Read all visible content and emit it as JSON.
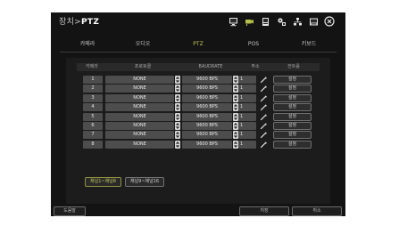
{
  "title": {
    "prefix": "장치>",
    "name": "PTZ"
  },
  "toolbar_icons": [
    "monitor-icon",
    "camera-icon",
    "record-icon",
    "network-icon",
    "storage-icon",
    "close-icon"
  ],
  "tabs": [
    {
      "label": "카메라",
      "active": false
    },
    {
      "label": "오디오",
      "active": false
    },
    {
      "label": "PTZ",
      "active": true
    },
    {
      "label": "POS",
      "active": false
    },
    {
      "label": "키보드",
      "active": false
    }
  ],
  "columns": [
    "카메라",
    "프로토콜",
    "BAUDRATE",
    "주소",
    "컨트롤"
  ],
  "rows": [
    {
      "camera": "1",
      "protocol": "NONE",
      "baud": "9600 BPS",
      "address": "1",
      "control": "설정"
    },
    {
      "camera": "2",
      "protocol": "NONE",
      "baud": "9600 BPS",
      "address": "1",
      "control": "설정"
    },
    {
      "camera": "3",
      "protocol": "NONE",
      "baud": "9600 BPS",
      "address": "1",
      "control": "설정"
    },
    {
      "camera": "4",
      "protocol": "NONE",
      "baud": "9600 BPS",
      "address": "1",
      "control": "설정"
    },
    {
      "camera": "5",
      "protocol": "NONE",
      "baud": "9600 BPS",
      "address": "1",
      "control": "설정"
    },
    {
      "camera": "6",
      "protocol": "NONE",
      "baud": "9600 BPS",
      "address": "1",
      "control": "설정"
    },
    {
      "camera": "7",
      "protocol": "NONE",
      "baud": "9600 BPS",
      "address": "1",
      "control": "설정"
    },
    {
      "camera": "8",
      "protocol": "NONE",
      "baud": "9600 BPS",
      "address": "1",
      "control": "설정"
    }
  ],
  "pages": [
    {
      "label": "채널1~채널8",
      "active": true
    },
    {
      "label": "채널9~채널16",
      "active": false
    }
  ],
  "footer": {
    "help": "도움말",
    "save": "저장",
    "cancel": "취소"
  },
  "colors": {
    "accent": "#c2c65a",
    "panel": "#131313",
    "cell": "#4d4d4d"
  }
}
